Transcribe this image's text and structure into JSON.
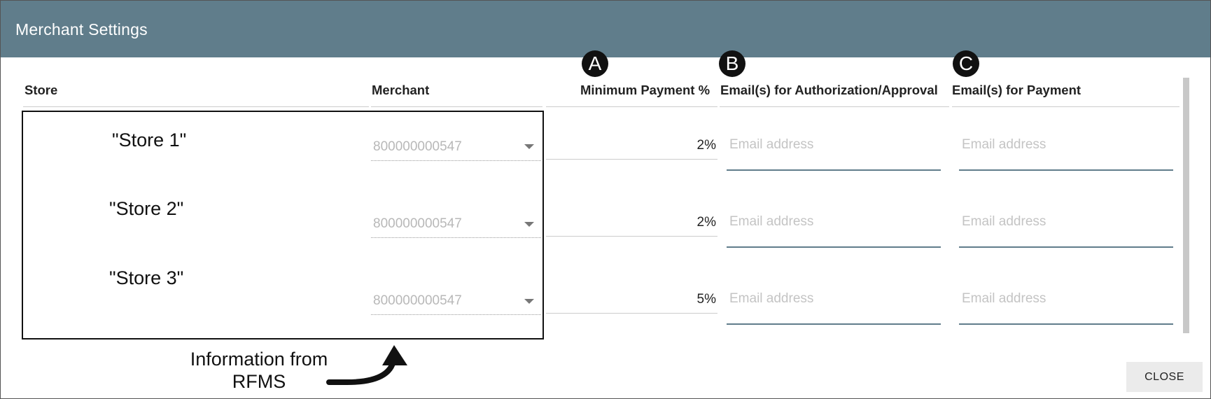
{
  "dialog": {
    "title": "Merchant Settings"
  },
  "columns": {
    "store": "Store",
    "merchant": "Merchant",
    "min_payment": "Minimum Payment %",
    "email_auth": "Email(s) for Authorization/Approval",
    "email_payment": "Email(s) for Payment"
  },
  "badges": {
    "a": "A",
    "b": "B",
    "c": "C"
  },
  "rows": [
    {
      "store": "\"Store 1\"",
      "merchant": "800000000547",
      "min_payment": "2%",
      "email_auth_placeholder": "Email address",
      "email_payment_placeholder": "Email address"
    },
    {
      "store": "\"Store 2\"",
      "merchant": "800000000547",
      "min_payment": "2%",
      "email_auth_placeholder": "Email address",
      "email_payment_placeholder": "Email address"
    },
    {
      "store": "\"Store 3\"",
      "merchant": "800000000547",
      "min_payment": "5%",
      "email_auth_placeholder": "Email address",
      "email_payment_placeholder": "Email address"
    }
  ],
  "annotation": {
    "line1": "Information from",
    "line2": "RFMS"
  },
  "buttons": {
    "close": "CLOSE"
  },
  "icons": {
    "merchant_dropdown": "chevron-down-icon",
    "annotation_arrow": "curved-arrow-icon"
  },
  "colors": {
    "header_bg": "#607d8b",
    "input_underline": "#607d8b",
    "badge_bg": "#111111"
  }
}
